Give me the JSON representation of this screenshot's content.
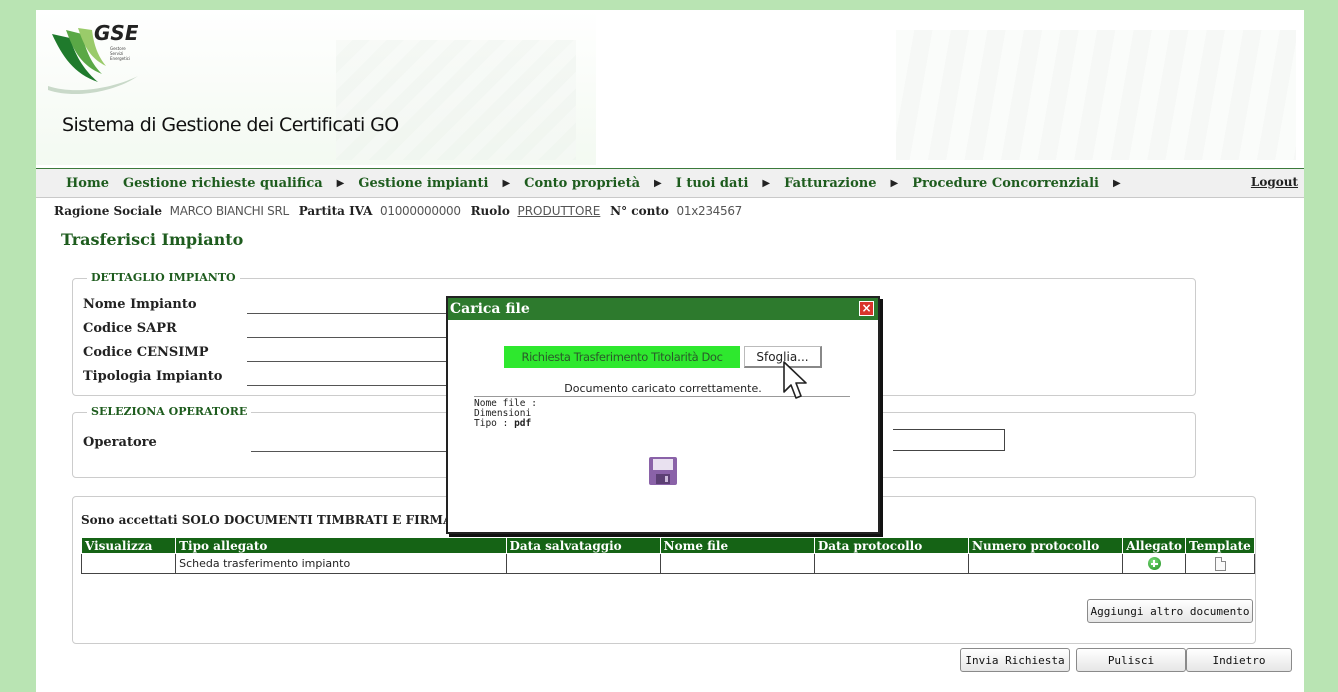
{
  "brand": {
    "logo_text": "GSE",
    "logo_sub": [
      "Gestore",
      "Servizi",
      "Energetici"
    ]
  },
  "app_title": "Sistema di Gestione dei Certificati GO",
  "nav": {
    "items": [
      "Home",
      "Gestione richieste qualifica",
      "Gestione impianti",
      "Conto proprietà",
      "I tuoi dati",
      "Fatturazione",
      "Procedure Concorrenziali"
    ],
    "logout": "Logout"
  },
  "info": {
    "ragione_label": "Ragione Sociale",
    "ragione_value": "MARCO BIANCHI SRL",
    "piva_label": "Partita IVA",
    "piva_value": "01000000000",
    "ruolo_label": "Ruolo",
    "ruolo_value": "PRODUTTORE",
    "conto_label": "N° conto",
    "conto_value": "01x234567"
  },
  "page_heading": "Trasferisci Impianto",
  "dettaglio": {
    "legend": "DETTAGLIO IMPIANTO",
    "fields": [
      "Nome Impianto",
      "Codice SAPR",
      "Codice CENSIMP",
      "Tipologia Impianto"
    ]
  },
  "operatore": {
    "legend": "SELEZIONA OPERATORE",
    "label": "Operatore"
  },
  "documents": {
    "note": "Sono accettati SOLO DOCUMENTI TIMBRATI E FIRMAT",
    "columns": [
      "Visualizza",
      "Tipo allegato",
      "Data salvataggio",
      "Nome file",
      "Data protocollo",
      "Numero protocollo",
      "Allegato",
      "Template"
    ],
    "rows": [
      {
        "tipo": "Scheda trasferimento impianto"
      }
    ],
    "add_button": "Aggiungi altro documento"
  },
  "actions": {
    "send": "Invia Richiesta",
    "clear": "Pulisci",
    "back": "Indietro"
  },
  "modal": {
    "title": "Carica file",
    "doc_type": "Richiesta Trasferimento Titolarità Doc",
    "browse": "Sfoglia...",
    "message": "Documento caricato correttamente.",
    "file_name_label": "Nome file :",
    "size_label": "Dimensioni",
    "type_label": "Tipo :",
    "type_value": "pdf"
  },
  "colors": {
    "nav_green": "#1e5c1e",
    "header_green": "#156315",
    "doc_type_bg": "#2ee82e",
    "close_red": "#d9342b",
    "side_bg": "#b9e4b3"
  },
  "icons": [
    "gse-logo",
    "close-icon",
    "plus-icon",
    "document-icon",
    "floppy-save-icon",
    "mouse-cursor-icon"
  ]
}
